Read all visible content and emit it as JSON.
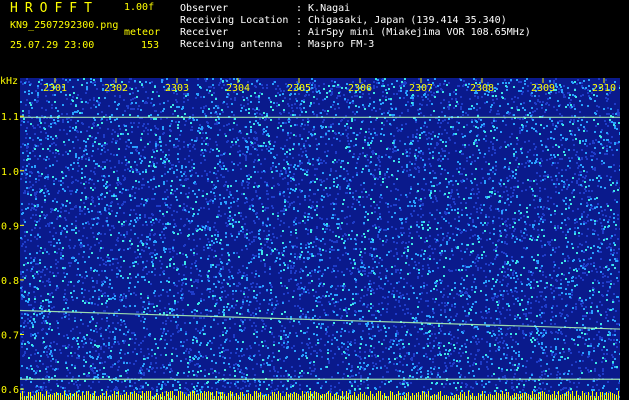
{
  "header": {
    "title": "HROFFT",
    "version": "1.00f",
    "filename": "KN9_2507292300.png",
    "mode": "meteor",
    "datetime": "25.07.29 23:00",
    "count": "153"
  },
  "info": [
    {
      "label": "Observer",
      "value": ": K.Nagai"
    },
    {
      "label": "Receiving Location",
      "value": ": Chigasaki, Japan (139.414 35.340)"
    },
    {
      "label": "Receiver",
      "value": ": AirSpy mini (Miakejima VOR 108.65MHz)"
    },
    {
      "label": "Receiving antenna",
      "value": ": Maspro FM-3"
    }
  ],
  "chart_data": {
    "type": "heatmap",
    "ylabel": "kHz",
    "ylim": [
      0.58,
      1.17
    ],
    "x_ticks": [
      "2301",
      "2302",
      "2303",
      "2304",
      "2305",
      "2306",
      "2307",
      "2308",
      "2309",
      "2310"
    ],
    "y_ticks": [
      "1.1",
      "1.0",
      "0.9",
      "0.8",
      "0.7",
      "0.6"
    ],
    "y_tick_values": [
      1.1,
      1.0,
      0.9,
      0.8,
      0.7,
      0.6
    ],
    "lines": [
      {
        "freq": 1.098,
        "x_start": 0,
        "x_end": 1
      },
      {
        "freq": 0.744,
        "freq_end": 0.71,
        "x_start": 0,
        "x_end": 1
      },
      {
        "freq": 0.618,
        "x_start": 0,
        "x_end": 1
      }
    ],
    "colors": {
      "background": "#0a1a8c",
      "noise_low": "#1e3cc8",
      "noise_mid": "#28a0ff",
      "noise_high": "#3ce6e6",
      "trace": "#b4ffb4",
      "axis": "#ffff00"
    }
  }
}
